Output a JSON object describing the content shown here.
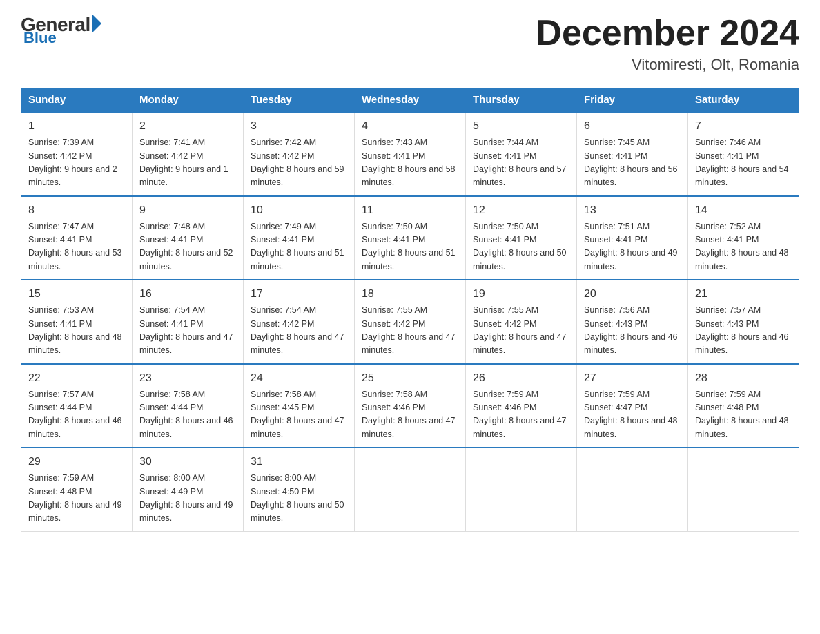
{
  "logo": {
    "general": "General",
    "blue": "Blue",
    "bottom": "Blue"
  },
  "header": {
    "month_title": "December 2024",
    "subtitle": "Vitomiresti, Olt, Romania"
  },
  "days_of_week": [
    "Sunday",
    "Monday",
    "Tuesday",
    "Wednesday",
    "Thursday",
    "Friday",
    "Saturday"
  ],
  "weeks": [
    [
      {
        "day": "1",
        "sunrise": "7:39 AM",
        "sunset": "4:42 PM",
        "daylight": "9 hours and 2 minutes."
      },
      {
        "day": "2",
        "sunrise": "7:41 AM",
        "sunset": "4:42 PM",
        "daylight": "9 hours and 1 minute."
      },
      {
        "day": "3",
        "sunrise": "7:42 AM",
        "sunset": "4:42 PM",
        "daylight": "8 hours and 59 minutes."
      },
      {
        "day": "4",
        "sunrise": "7:43 AM",
        "sunset": "4:41 PM",
        "daylight": "8 hours and 58 minutes."
      },
      {
        "day": "5",
        "sunrise": "7:44 AM",
        "sunset": "4:41 PM",
        "daylight": "8 hours and 57 minutes."
      },
      {
        "day": "6",
        "sunrise": "7:45 AM",
        "sunset": "4:41 PM",
        "daylight": "8 hours and 56 minutes."
      },
      {
        "day": "7",
        "sunrise": "7:46 AM",
        "sunset": "4:41 PM",
        "daylight": "8 hours and 54 minutes."
      }
    ],
    [
      {
        "day": "8",
        "sunrise": "7:47 AM",
        "sunset": "4:41 PM",
        "daylight": "8 hours and 53 minutes."
      },
      {
        "day": "9",
        "sunrise": "7:48 AM",
        "sunset": "4:41 PM",
        "daylight": "8 hours and 52 minutes."
      },
      {
        "day": "10",
        "sunrise": "7:49 AM",
        "sunset": "4:41 PM",
        "daylight": "8 hours and 51 minutes."
      },
      {
        "day": "11",
        "sunrise": "7:50 AM",
        "sunset": "4:41 PM",
        "daylight": "8 hours and 51 minutes."
      },
      {
        "day": "12",
        "sunrise": "7:50 AM",
        "sunset": "4:41 PM",
        "daylight": "8 hours and 50 minutes."
      },
      {
        "day": "13",
        "sunrise": "7:51 AM",
        "sunset": "4:41 PM",
        "daylight": "8 hours and 49 minutes."
      },
      {
        "day": "14",
        "sunrise": "7:52 AM",
        "sunset": "4:41 PM",
        "daylight": "8 hours and 48 minutes."
      }
    ],
    [
      {
        "day": "15",
        "sunrise": "7:53 AM",
        "sunset": "4:41 PM",
        "daylight": "8 hours and 48 minutes."
      },
      {
        "day": "16",
        "sunrise": "7:54 AM",
        "sunset": "4:41 PM",
        "daylight": "8 hours and 47 minutes."
      },
      {
        "day": "17",
        "sunrise": "7:54 AM",
        "sunset": "4:42 PM",
        "daylight": "8 hours and 47 minutes."
      },
      {
        "day": "18",
        "sunrise": "7:55 AM",
        "sunset": "4:42 PM",
        "daylight": "8 hours and 47 minutes."
      },
      {
        "day": "19",
        "sunrise": "7:55 AM",
        "sunset": "4:42 PM",
        "daylight": "8 hours and 47 minutes."
      },
      {
        "day": "20",
        "sunrise": "7:56 AM",
        "sunset": "4:43 PM",
        "daylight": "8 hours and 46 minutes."
      },
      {
        "day": "21",
        "sunrise": "7:57 AM",
        "sunset": "4:43 PM",
        "daylight": "8 hours and 46 minutes."
      }
    ],
    [
      {
        "day": "22",
        "sunrise": "7:57 AM",
        "sunset": "4:44 PM",
        "daylight": "8 hours and 46 minutes."
      },
      {
        "day": "23",
        "sunrise": "7:58 AM",
        "sunset": "4:44 PM",
        "daylight": "8 hours and 46 minutes."
      },
      {
        "day": "24",
        "sunrise": "7:58 AM",
        "sunset": "4:45 PM",
        "daylight": "8 hours and 47 minutes."
      },
      {
        "day": "25",
        "sunrise": "7:58 AM",
        "sunset": "4:46 PM",
        "daylight": "8 hours and 47 minutes."
      },
      {
        "day": "26",
        "sunrise": "7:59 AM",
        "sunset": "4:46 PM",
        "daylight": "8 hours and 47 minutes."
      },
      {
        "day": "27",
        "sunrise": "7:59 AM",
        "sunset": "4:47 PM",
        "daylight": "8 hours and 48 minutes."
      },
      {
        "day": "28",
        "sunrise": "7:59 AM",
        "sunset": "4:48 PM",
        "daylight": "8 hours and 48 minutes."
      }
    ],
    [
      {
        "day": "29",
        "sunrise": "7:59 AM",
        "sunset": "4:48 PM",
        "daylight": "8 hours and 49 minutes."
      },
      {
        "day": "30",
        "sunrise": "8:00 AM",
        "sunset": "4:49 PM",
        "daylight": "8 hours and 49 minutes."
      },
      {
        "day": "31",
        "sunrise": "8:00 AM",
        "sunset": "4:50 PM",
        "daylight": "8 hours and 50 minutes."
      },
      null,
      null,
      null,
      null
    ]
  ]
}
